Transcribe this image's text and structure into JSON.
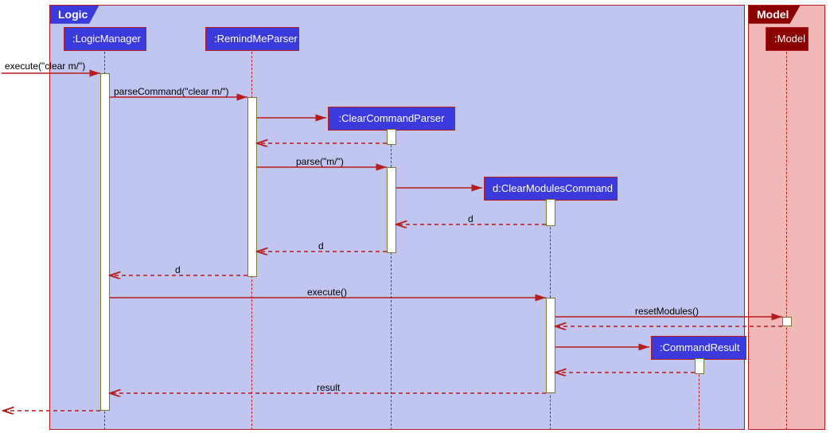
{
  "frames": {
    "logic": {
      "label": "Logic"
    },
    "model": {
      "label": "Model"
    }
  },
  "participants": {
    "logicManager": ":LogicManager",
    "remindMeParser": ":RemindMeParser",
    "clearCommandParser": ":ClearCommandParser",
    "clearModulesCommand": "d:ClearModulesCommand",
    "commandResult": ":CommandResult",
    "model": ":Model"
  },
  "messages": {
    "executeIn": "execute(\"clear m/\")",
    "parseCommand": "parseCommand(\"clear m/\")",
    "parse": "parse(\"m/\")",
    "returnD1": "d",
    "returnD2": "d",
    "returnD3": "d",
    "executeCmd": "execute()",
    "resetModules": "resetModules()",
    "result": "result"
  },
  "chart_data": {
    "type": "sequence-diagram",
    "frames": [
      {
        "name": "Logic",
        "participants": [
          ":LogicManager",
          ":RemindMeParser",
          ":ClearCommandParser",
          "d:ClearModulesCommand",
          ":CommandResult"
        ]
      },
      {
        "name": "Model",
        "participants": [
          ":Model"
        ]
      }
    ],
    "participants": [
      ":LogicManager",
      ":RemindMeParser",
      ":ClearCommandParser",
      "d:ClearModulesCommand",
      ":CommandResult",
      ":Model"
    ],
    "messages": [
      {
        "from": "caller",
        "to": ":LogicManager",
        "label": "execute(\"clear m/\")",
        "type": "sync"
      },
      {
        "from": ":LogicManager",
        "to": ":RemindMeParser",
        "label": "parseCommand(\"clear m/\")",
        "type": "sync"
      },
      {
        "from": ":RemindMeParser",
        "to": ":ClearCommandParser",
        "label": "",
        "type": "create"
      },
      {
        "from": ":ClearCommandParser",
        "to": ":RemindMeParser",
        "label": "",
        "type": "return"
      },
      {
        "from": ":RemindMeParser",
        "to": ":ClearCommandParser",
        "label": "parse(\"m/\")",
        "type": "sync"
      },
      {
        "from": ":ClearCommandParser",
        "to": "d:ClearModulesCommand",
        "label": "",
        "type": "create"
      },
      {
        "from": "d:ClearModulesCommand",
        "to": ":ClearCommandParser",
        "label": "d",
        "type": "return"
      },
      {
        "from": ":ClearCommandParser",
        "to": ":RemindMeParser",
        "label": "d",
        "type": "return"
      },
      {
        "from": ":RemindMeParser",
        "to": ":LogicManager",
        "label": "d",
        "type": "return"
      },
      {
        "from": ":LogicManager",
        "to": "d:ClearModulesCommand",
        "label": "execute()",
        "type": "sync"
      },
      {
        "from": "d:ClearModulesCommand",
        "to": ":Model",
        "label": "resetModules()",
        "type": "sync"
      },
      {
        "from": ":Model",
        "to": "d:ClearModulesCommand",
        "label": "",
        "type": "return"
      },
      {
        "from": "d:ClearModulesCommand",
        "to": ":CommandResult",
        "label": "",
        "type": "create"
      },
      {
        "from": ":CommandResult",
        "to": "d:ClearModulesCommand",
        "label": "",
        "type": "return"
      },
      {
        "from": "d:ClearModulesCommand",
        "to": ":LogicManager",
        "label": "result",
        "type": "return"
      },
      {
        "from": ":LogicManager",
        "to": "caller",
        "label": "",
        "type": "return"
      }
    ]
  }
}
